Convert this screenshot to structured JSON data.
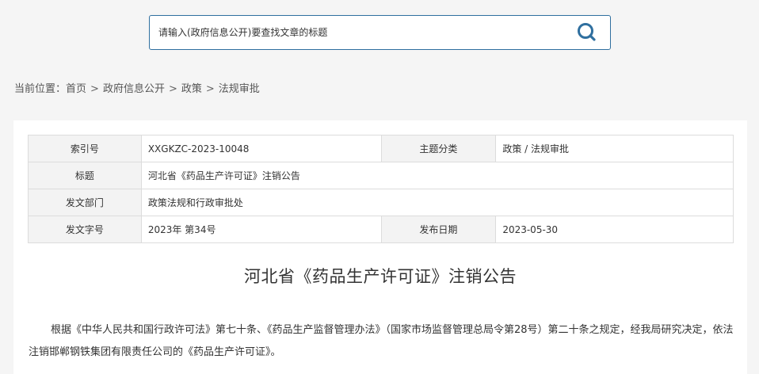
{
  "search": {
    "placeholder": "请输入(政府信息公开)要查找文章的标题"
  },
  "icons": {
    "search": "search-icon",
    "accent_color": "#2f6f9f"
  },
  "breadcrumb": {
    "prefix": "当前位置：",
    "items": [
      "首页",
      "政府信息公开",
      "政策",
      "法规审批"
    ],
    "separator": ">"
  },
  "meta": {
    "index_label": "索引号",
    "index_value": "XXGKZC-2023-10048",
    "topic_label": "主题分类",
    "topic_value": "政策 / 法规审批",
    "title_label": "标题",
    "title_value": "河北省《药品生产许可证》注销公告",
    "dept_label": "发文部门",
    "dept_value": "政策法规和行政审批处",
    "docno_label": "发文字号",
    "docno_value": "2023年 第34号",
    "date_label": "发布日期",
    "date_value": "2023-05-30"
  },
  "article": {
    "title": "河北省《药品生产许可证》注销公告",
    "body": "根据《中华人民共和国行政许可法》第七十条、《药品生产监督管理办法》（国家市场监督管理总局令第28号）第二十条之规定，经我局研究决定，依法注销邯郸钢铁集团有限责任公司的《药品生产许可证》。"
  }
}
